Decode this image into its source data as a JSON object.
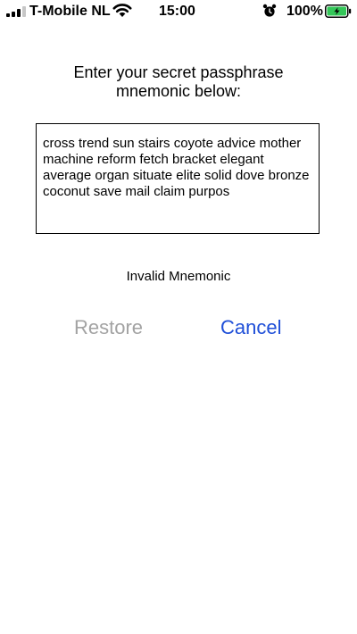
{
  "status_bar": {
    "carrier": "T-Mobile NL",
    "time": "15:00",
    "battery_percent": "100%",
    "battery_level": 1.0,
    "icons": [
      "signal-icon",
      "wifi-icon",
      "alarm-icon",
      "battery-icon"
    ]
  },
  "restore_screen": {
    "prompt_line1": "Enter your secret passphrase",
    "prompt_line2": "mnemonic below:",
    "mnemonic_text": "cross trend sun stairs coyote advice mother machine reform fetch bracket elegant average organ situate elite solid dove bronze coconut save mail claim purpos",
    "status_message": "Invalid Mnemonic",
    "restore_label": "Restore",
    "cancel_label": "Cancel"
  },
  "colors": {
    "restore_disabled": "#a3a3a3",
    "cancel_link": "#1f4fd8",
    "battery_fill": "#34c759"
  }
}
